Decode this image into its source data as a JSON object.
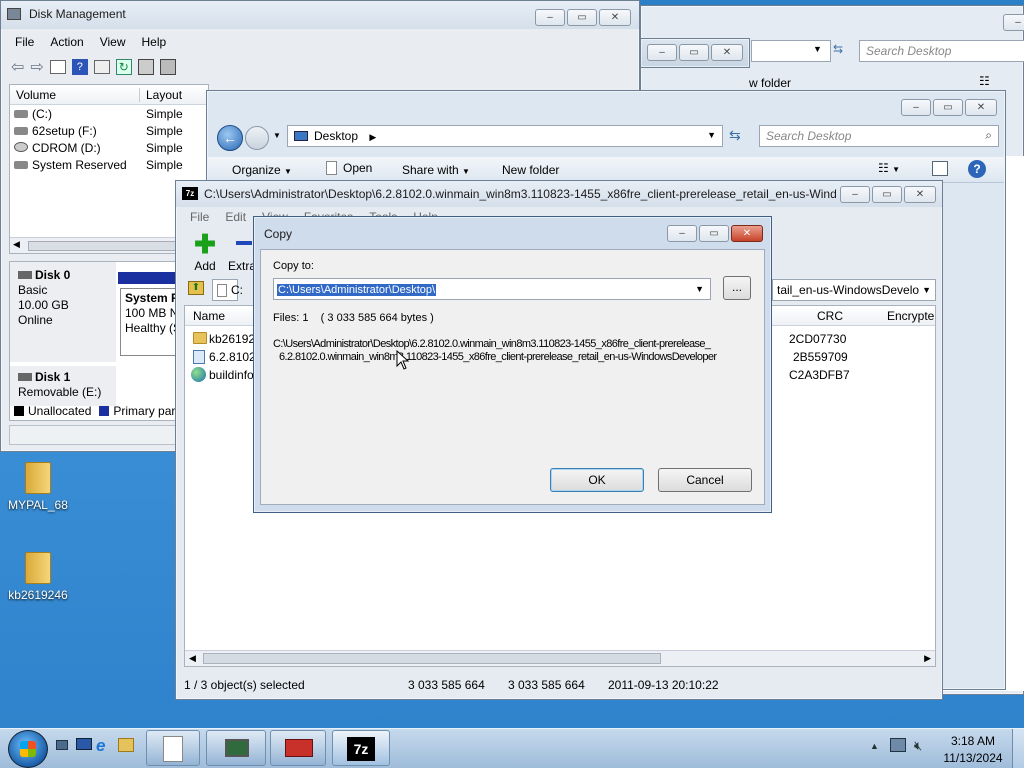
{
  "colors": {
    "desktop": "#2f83cc",
    "taskbar": "#a7c4e2",
    "primary_partition": "#1a2fa0",
    "unallocated": "#000000"
  },
  "disk_mgmt": {
    "title": "Disk Management",
    "menu": [
      "File",
      "Action",
      "View",
      "Help"
    ],
    "columns": [
      "Volume",
      "Layout"
    ],
    "volumes": [
      {
        "name": "(C:)",
        "layout": "Simple"
      },
      {
        "name": "62setup (F:)",
        "layout": "Simple"
      },
      {
        "name": "CDROM (D:)",
        "layout": "Simple"
      },
      {
        "name": "System Reserved",
        "layout": "Simple"
      }
    ],
    "disk0": {
      "label": "Disk 0",
      "type": "Basic",
      "size": "10.00 GB",
      "status": "Online",
      "partition_name": "System R",
      "partition_size": "100 MB NT",
      "partition_health": "Healthy (S"
    },
    "disk1": {
      "label": "Disk 1",
      "type": "Removable (E:)"
    },
    "legend": {
      "unallocated": "Unallocated",
      "primary": "Primary par"
    }
  },
  "bg_explorer": {
    "search_placeholder": "Search Desktop",
    "new_folder": "w folder"
  },
  "explorer": {
    "location": "Desktop",
    "search_placeholder": "Search Desktop",
    "toolbar": {
      "organize": "Organize",
      "open": "Open",
      "share": "Share with",
      "new_folder": "New folder"
    }
  },
  "sevenzip": {
    "title": "C:\\Users\\Administrator\\Desktop\\6.2.8102.0.winmain_win8m3.110823-1455_x86fre_client-prerelease_retail_en-us-Wind...",
    "menu": [
      "File",
      "Edit",
      "View",
      "Favorites",
      "Tools",
      "Help"
    ],
    "toolbar": {
      "add": "Add",
      "extract": "Extra"
    },
    "path_short": "C:",
    "path_tail": "tail_en-us-WindowsDevelo",
    "columns": {
      "name": "Name",
      "crc": "CRC",
      "encrypted": "Encrypte"
    },
    "files": [
      {
        "name": "kb261924",
        "crc": "2CD07730",
        "icon": "folder-icon"
      },
      {
        "name": "6.2.8102.",
        "crc": "2B559709",
        "icon": "file-icon"
      },
      {
        "name": "buildinfo",
        "crc": "C2A3DFB7",
        "icon": "globe-icon"
      }
    ],
    "status": {
      "selected": "1 / 3 object(s) selected",
      "size": "3 033 585 664",
      "packed": "3 033 585 664",
      "modified": "2011-09-13 20:10:22"
    }
  },
  "copy_dialog": {
    "title": "Copy",
    "copy_to_label": "Copy to:",
    "path": "C:\\Users\\Administrator\\Desktop\\",
    "browse": "...",
    "files_info": "Files: 1    ( 3 033 585 664 bytes )",
    "line1": "C:\\Users\\Administrator\\Desktop\\6.2.8102.0.winmain_win8m3.110823-1455_x86fre_client-prerelease_",
    "line2": "6.2.8102.0.winmain_win8m3.110823-1455_x86fre_client-prerelease_retail_en-us-WindowsDeveloper",
    "ok": "OK",
    "cancel": "Cancel"
  },
  "desktop_icons": [
    {
      "label": "MYPAL_68"
    },
    {
      "label": "kb2619246"
    }
  ],
  "taskbar": {
    "time": "3:18 AM",
    "date": "11/13/2024"
  }
}
